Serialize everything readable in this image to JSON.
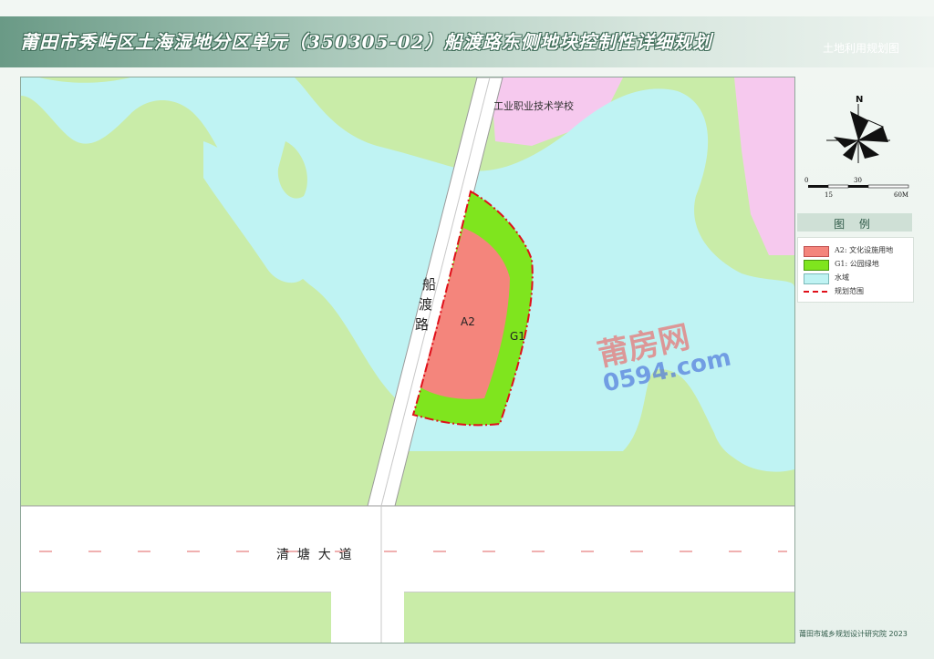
{
  "header": {
    "title": "莆田市秀屿区土海湿地分区单元（350305-02）船渡路东侧地块控制性详细规划",
    "subtitle": "土地利用规划图"
  },
  "map_labels": {
    "school": "工业职业技术学校",
    "road_vertical": [
      "船",
      "渡",
      "路"
    ],
    "road_horizontal": "清  塘  大  道",
    "parcel_a2": "A2",
    "parcel_g1": "G1"
  },
  "compass": {
    "north": "N"
  },
  "scale_bar": {
    "ticks": [
      "0",
      "15",
      "30",
      "60M"
    ]
  },
  "legend": {
    "title": "图 例",
    "items": [
      {
        "label": "A2: 文化设施用地",
        "color": "#f4857c",
        "type": "fill"
      },
      {
        "label": "G1: 公园绿地",
        "color": "#7fe51e",
        "type": "fill"
      },
      {
        "label": "水域",
        "color": "#bff3f3",
        "type": "fill"
      },
      {
        "label": "规划范围",
        "color": "#e0101a",
        "type": "line"
      }
    ]
  },
  "watermark": {
    "line1": "莆房网",
    "line2": "0594.com"
  },
  "footer": {
    "text": "莆田市城乡规划设计研究院   2023"
  },
  "colors": {
    "land": "#c9eca8",
    "water": "#bff3f3",
    "school_land": "#f6c9ee",
    "cultural": "#f4857c",
    "park": "#7fe51e",
    "road": "#ffffff",
    "boundary": "#e0101a"
  }
}
